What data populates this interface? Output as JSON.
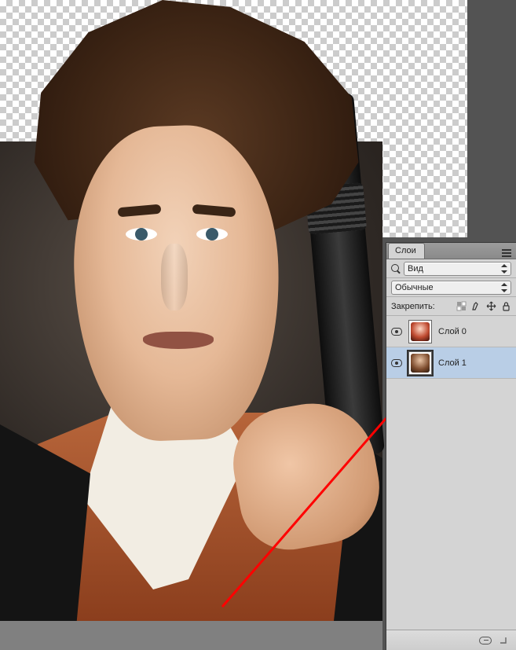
{
  "panel": {
    "tab_label": "Слои",
    "filter_label": "Вид",
    "blend_mode": "Обычные",
    "lock_label": "Закрепить:"
  },
  "layers": [
    {
      "name": "Слой 0",
      "selected": false
    },
    {
      "name": "Слой 1",
      "selected": true
    }
  ]
}
